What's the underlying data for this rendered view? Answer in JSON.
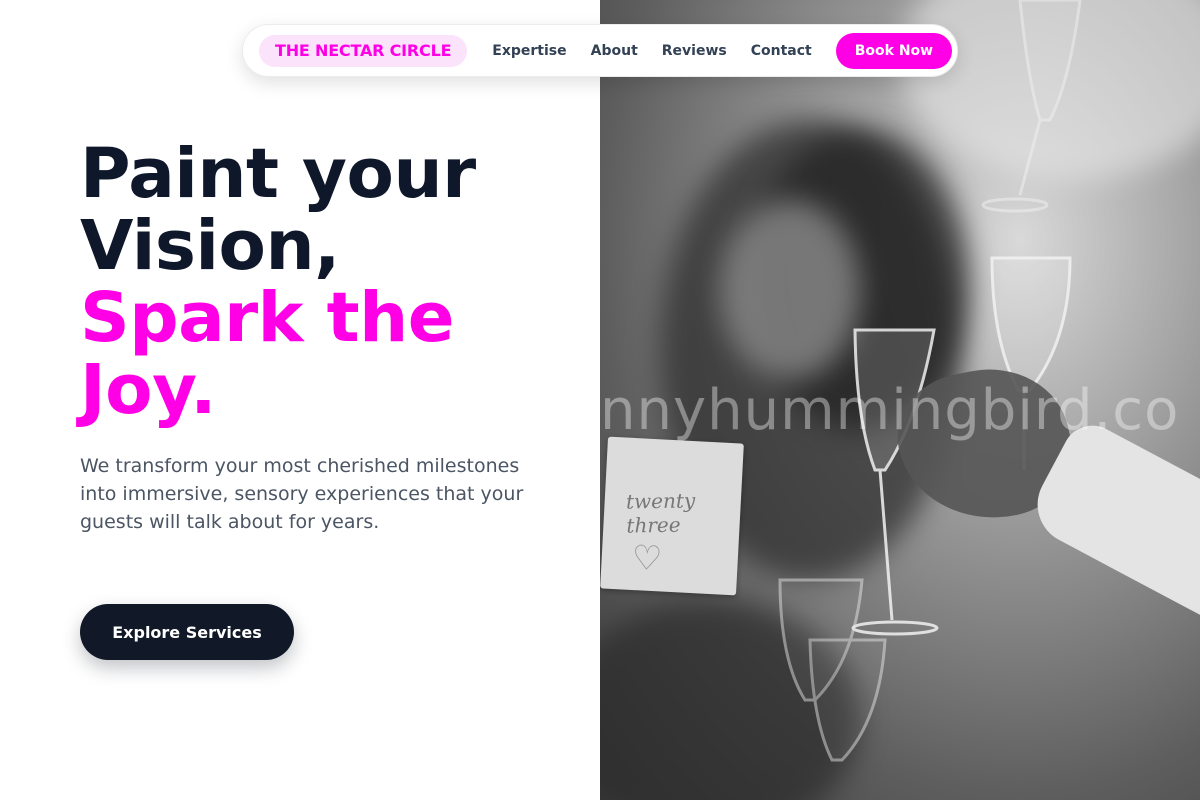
{
  "nav": {
    "brand": "THE NECTAR CIRCLE",
    "links": [
      "Expertise",
      "About",
      "Reviews",
      "Contact"
    ],
    "cta": "Book Now"
  },
  "hero": {
    "headline_line1": "Paint your",
    "headline_line2": "Vision,",
    "headline_accent1": "Spark the",
    "headline_accent2": "Joy.",
    "subtext": "We transform your most cherished milestones into immersive, sensory experiences that your guests will talk about for years.",
    "cta": "Explore Services"
  },
  "photo": {
    "watermark": "nnyhummingbird.co",
    "card_text": "twenty three"
  },
  "colors": {
    "accent": "#ff00e6",
    "dark": "#0f172a",
    "brand_bg": "#fbe3fb"
  },
  "icons": {
    "card_heart": "heart-icon"
  }
}
